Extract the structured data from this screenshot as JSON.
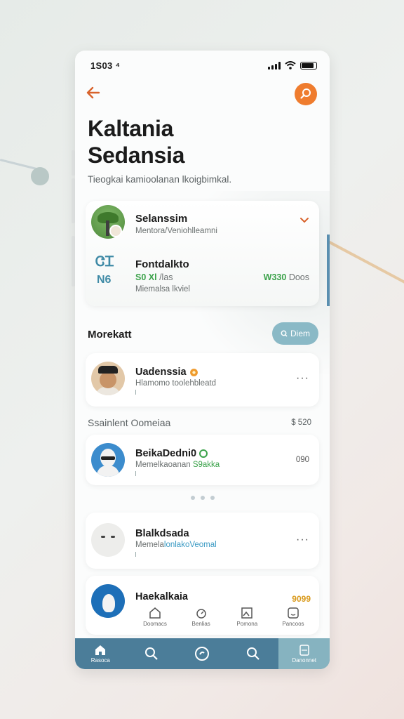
{
  "status_bar": {
    "time": "1S03 ⁴"
  },
  "header": {
    "title_line1": "Kaltania",
    "title_line2": "Sedansia",
    "subtitle": "Tieogkai kamioolanan lkoigbimkal."
  },
  "summary_card": {
    "name": "Selanssim",
    "sub": "Mentora/Veniohlleamni",
    "glyph": "ᏣᏆ",
    "code": "N6",
    "feature_title": "Fontdalkto",
    "feature_value_green": "S0 Xl",
    "feature_value_muted": "/las",
    "feature_sub": "Miemalsa lkviel",
    "right_value_green": "W330",
    "right_value_muted": "Doos"
  },
  "section": {
    "title": "Morekatt",
    "pill_label": "Diem"
  },
  "people": [
    {
      "name": "Uadenssia",
      "sub": "Hlamomo toolehbleatd",
      "more": "···"
    },
    {
      "name": "BeikaDedni0",
      "sub_prefix": "Memelkaoanan ",
      "sub_highlight": "S9akka",
      "value": "090"
    },
    {
      "name": "Blalkdsada",
      "sub_prefix": "Memela",
      "sub_highlight": "lonlakoVeomal",
      "more": "···"
    },
    {
      "name": "Haekalkaia",
      "gold": "9099"
    }
  ],
  "separator": {
    "label": "Ssainlent Oomeiaa",
    "value": "$ 520"
  },
  "mini_nav": [
    "Doomacs",
    "Benlias",
    "Pomona",
    "Pancoos"
  ],
  "tabbar": [
    "Rasoca",
    "",
    "",
    "",
    "Danonnet"
  ],
  "colors": {
    "accent_orange": "#ef7c2e",
    "accent_teal": "#8ab9c6",
    "tabbar": "#4b7d99",
    "green": "#3ba24a"
  }
}
